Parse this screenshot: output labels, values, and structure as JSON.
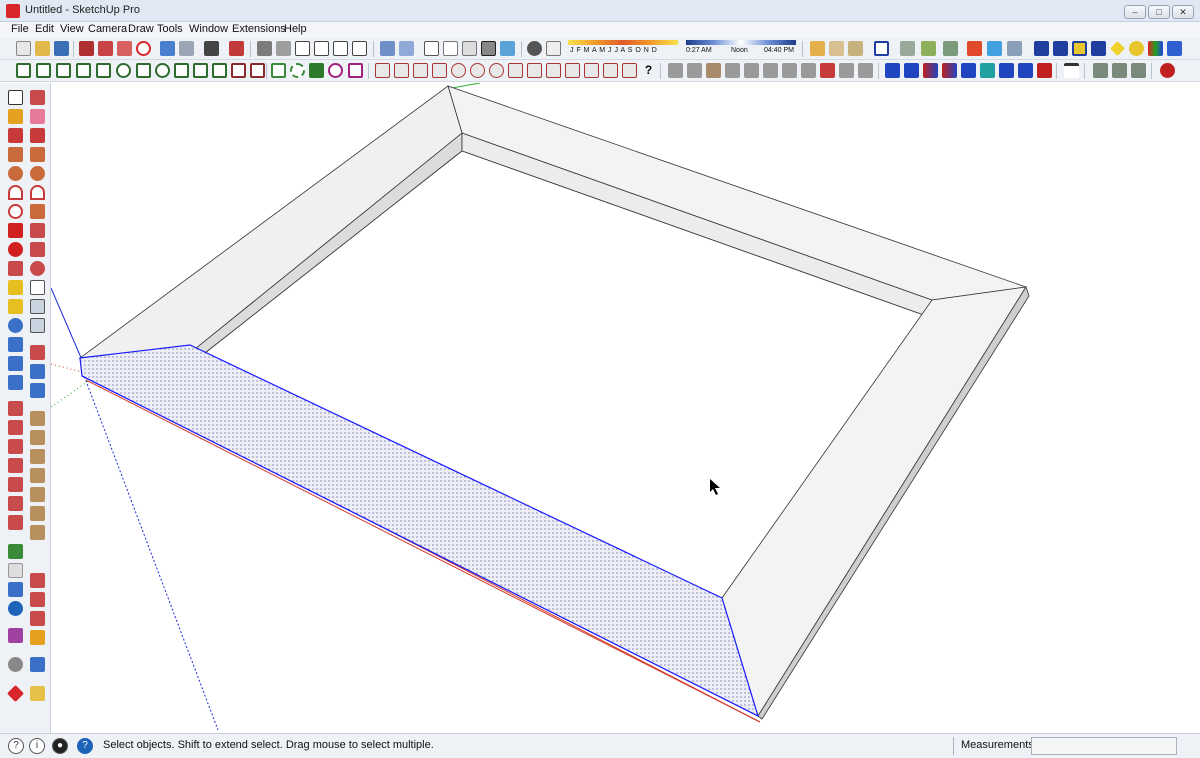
{
  "window": {
    "title": "Untitled - SketchUp Pro",
    "minimize": "–",
    "maximize": "□",
    "close": "✕"
  },
  "menu": [
    "File",
    "Edit",
    "View",
    "Camera",
    "Draw",
    "Tools",
    "Window",
    "Extensions",
    "Help"
  ],
  "shadow_settings": {
    "months": "J F M A M J J A S O N D",
    "time_start": "0:27 AM",
    "time_mid": "Noon",
    "time_end": "04:40 PM"
  },
  "status": {
    "message": "Select objects. Shift to extend select. Drag mouse to select multiple.",
    "measurements_label": "Measurements",
    "measurements_value": ""
  },
  "colors": {
    "selection": "#1a1aff",
    "x_axis": "#d43a2a",
    "y_axis": "#2db12d",
    "z_axis": "#1a2bd6",
    "face": "#f2f2f2",
    "inner_wall": "#dcdcdc",
    "accent": "#d9262c"
  }
}
